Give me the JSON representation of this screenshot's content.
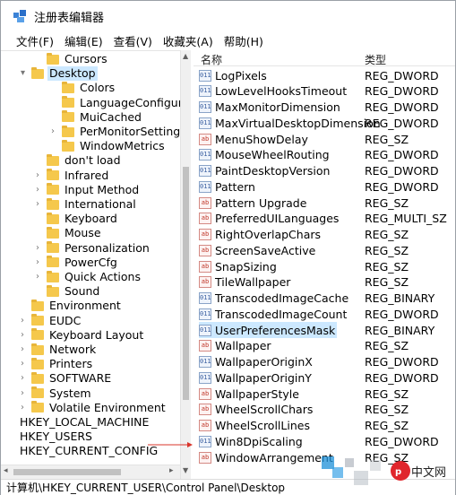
{
  "window": {
    "title": "注册表编辑器"
  },
  "menu": [
    "文件(F)",
    "编辑(E)",
    "查看(V)",
    "收藏夹(A)",
    "帮助(H)"
  ],
  "tree": {
    "rows": [
      {
        "label": "Cursors",
        "expander": ""
      },
      {
        "label": "Desktop",
        "expander": "▾",
        "selected": true
      },
      {
        "label": "Colors",
        "expander": ""
      },
      {
        "label": "LanguageConfiguration",
        "expander": ""
      },
      {
        "label": "MuiCached",
        "expander": ""
      },
      {
        "label": "PerMonitorSettings",
        "expander": "›"
      },
      {
        "label": "WindowMetrics",
        "expander": ""
      },
      {
        "label": "don't load",
        "expander": ""
      },
      {
        "label": "Infrared",
        "expander": "›"
      },
      {
        "label": "Input Method",
        "expander": "›"
      },
      {
        "label": "International",
        "expander": "›"
      },
      {
        "label": "Keyboard",
        "expander": ""
      },
      {
        "label": "Mouse",
        "expander": ""
      },
      {
        "label": "Personalization",
        "expander": "›"
      },
      {
        "label": "PowerCfg",
        "expander": "›"
      },
      {
        "label": "Quick Actions",
        "expander": "›"
      },
      {
        "label": "Sound",
        "expander": ""
      },
      {
        "label": "Environment",
        "expander": ""
      },
      {
        "label": "EUDC",
        "expander": "›"
      },
      {
        "label": "Keyboard Layout",
        "expander": "›"
      },
      {
        "label": "Network",
        "expander": "›"
      },
      {
        "label": "Printers",
        "expander": "›"
      },
      {
        "label": "SOFTWARE",
        "expander": "›"
      },
      {
        "label": "System",
        "expander": "›"
      },
      {
        "label": "Volatile Environment",
        "expander": "›"
      },
      {
        "label": "HKEY_LOCAL_MACHINE",
        "expander": "›"
      },
      {
        "label": "HKEY_USERS",
        "expander": "›"
      },
      {
        "label": "HKEY_CURRENT_CONFIG",
        "expander": "›"
      }
    ]
  },
  "list": {
    "header_name": "名称",
    "header_type": "类型",
    "rows": [
      {
        "name": "LogPixels",
        "type": "REG_DWORD",
        "icon": "dword"
      },
      {
        "name": "LowLevelHooksTimeout",
        "type": "REG_DWORD",
        "icon": "dword"
      },
      {
        "name": "MaxMonitorDimension",
        "type": "REG_DWORD",
        "icon": "dword"
      },
      {
        "name": "MaxVirtualDesktopDimension",
        "type": "REG_DWORD",
        "icon": "dword"
      },
      {
        "name": "MenuShowDelay",
        "type": "REG_SZ",
        "icon": "sz"
      },
      {
        "name": "MouseWheelRouting",
        "type": "REG_DWORD",
        "icon": "dword"
      },
      {
        "name": "PaintDesktopVersion",
        "type": "REG_DWORD",
        "icon": "dword"
      },
      {
        "name": "Pattern",
        "type": "REG_DWORD",
        "icon": "dword"
      },
      {
        "name": "Pattern Upgrade",
        "type": "REG_SZ",
        "icon": "sz"
      },
      {
        "name": "PreferredUILanguages",
        "type": "REG_MULTI_SZ",
        "icon": "sz"
      },
      {
        "name": "RightOverlapChars",
        "type": "REG_SZ",
        "icon": "sz"
      },
      {
        "name": "ScreenSaveActive",
        "type": "REG_SZ",
        "icon": "sz"
      },
      {
        "name": "SnapSizing",
        "type": "REG_SZ",
        "icon": "sz"
      },
      {
        "name": "TileWallpaper",
        "type": "REG_SZ",
        "icon": "sz"
      },
      {
        "name": "TranscodedImageCache",
        "type": "REG_BINARY",
        "icon": "dword"
      },
      {
        "name": "TranscodedImageCount",
        "type": "REG_DWORD",
        "icon": "dword"
      },
      {
        "name": "UserPreferencesMask",
        "type": "REG_BINARY",
        "icon": "dword",
        "selected": true
      },
      {
        "name": "Wallpaper",
        "type": "REG_SZ",
        "icon": "sz"
      },
      {
        "name": "WallpaperOriginX",
        "type": "REG_DWORD",
        "icon": "dword"
      },
      {
        "name": "WallpaperOriginY",
        "type": "REG_DWORD",
        "icon": "dword"
      },
      {
        "name": "WallpaperStyle",
        "type": "REG_SZ",
        "icon": "sz"
      },
      {
        "name": "WheelScrollChars",
        "type": "REG_SZ",
        "icon": "sz"
      },
      {
        "name": "WheelScrollLines",
        "type": "REG_SZ",
        "icon": "sz"
      },
      {
        "name": "Win8DpiScaling",
        "type": "REG_DWORD",
        "icon": "dword"
      },
      {
        "name": "WindowArrangement",
        "type": "REG_SZ",
        "icon": "sz"
      }
    ]
  },
  "status": {
    "path": "计算机\\HKEY_CURRENT_USER\\Control Panel\\Desktop"
  },
  "watermark": {
    "text": "php中文网"
  },
  "colors": {
    "selection": "#cce8ff",
    "folder": "#f5c84c",
    "arrow": "#d9342b"
  }
}
